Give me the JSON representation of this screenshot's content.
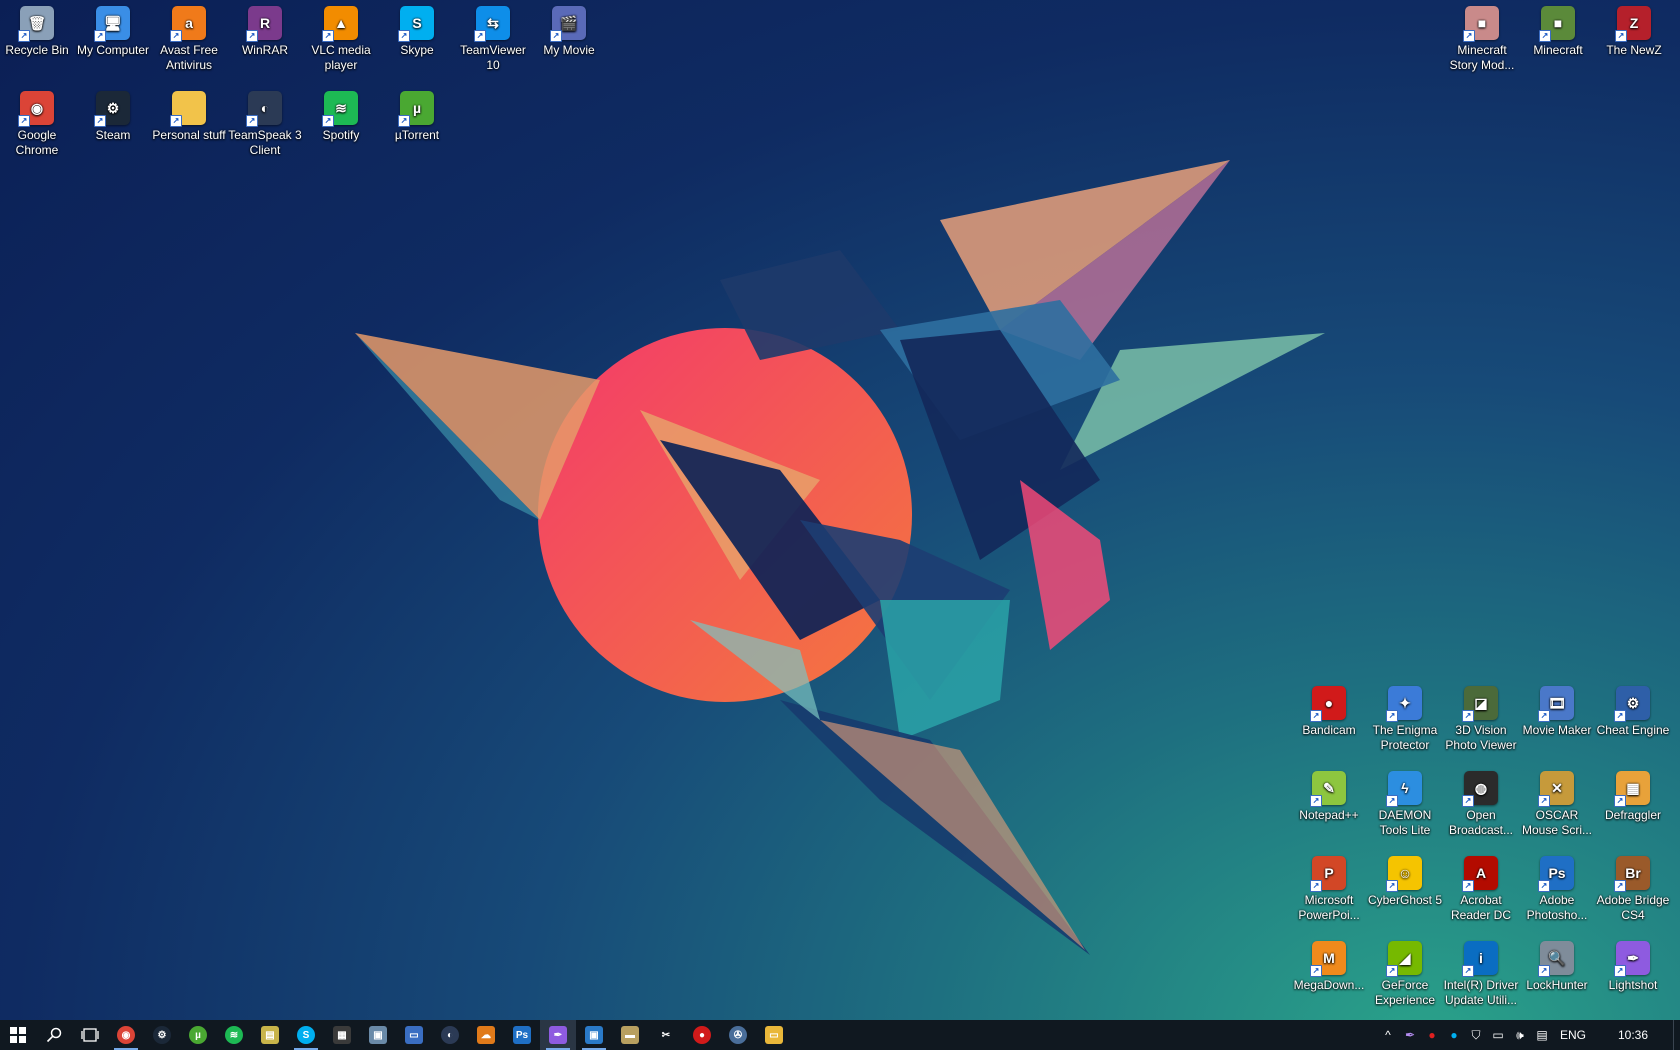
{
  "desktop": {
    "icons_left": [
      {
        "label": "Recycle Bin",
        "icon": "recycle-bin-icon",
        "glyph": "🗑",
        "color": "#8aa0b8"
      },
      {
        "label": "My Computer",
        "icon": "computer-icon",
        "glyph": "🖥",
        "color": "#3a8ee6"
      },
      {
        "label": "Avast Free Antivirus",
        "icon": "avast-icon",
        "glyph": "a",
        "color": "#f07a1a"
      },
      {
        "label": "WinRAR",
        "icon": "winrar-icon",
        "glyph": "R",
        "color": "#7b3a8c"
      },
      {
        "label": "VLC media player",
        "icon": "vlc-icon",
        "glyph": "▲",
        "color": "#f28c00"
      },
      {
        "label": "Skype",
        "icon": "skype-icon",
        "glyph": "S",
        "color": "#00aff0"
      },
      {
        "label": "TeamViewer 10",
        "icon": "teamviewer-icon",
        "glyph": "⇆",
        "color": "#0e8ee9"
      },
      {
        "label": "My Movie",
        "icon": "movie-icon",
        "glyph": "🎬",
        "color": "#5a6ab8"
      },
      {
        "label": "Google Chrome",
        "icon": "chrome-icon",
        "glyph": "◉",
        "color": "#db4437"
      },
      {
        "label": "Steam",
        "icon": "steam-icon",
        "glyph": "⚙",
        "color": "#1b2838"
      },
      {
        "label": "Personal stuff",
        "icon": "folder-icon",
        "glyph": "",
        "color": "#f2c34a"
      },
      {
        "label": "TeamSpeak 3 Client",
        "icon": "teamspeak-icon",
        "glyph": "◐",
        "color": "#2b3a55"
      },
      {
        "label": "Spotify",
        "icon": "spotify-icon",
        "glyph": "≋",
        "color": "#1db954"
      },
      {
        "label": "µTorrent",
        "icon": "utorrent-icon",
        "glyph": "µ",
        "color": "#4aa832"
      }
    ],
    "icons_top_right": [
      {
        "label": "Minecraft Story Mod...",
        "icon": "minecraft-story-icon",
        "glyph": "■",
        "color": "#c98a8a"
      },
      {
        "label": "Minecraft",
        "icon": "minecraft-icon",
        "glyph": "■",
        "color": "#5b8a3a"
      },
      {
        "label": "The NewZ",
        "icon": "thenewz-icon",
        "glyph": "Z",
        "color": "#b5202b"
      }
    ],
    "icons_bottom_right": [
      {
        "label": "Bandicam",
        "icon": "bandicam-icon",
        "glyph": "●",
        "color": "#d11a1a"
      },
      {
        "label": "The Enigma Protector",
        "icon": "enigma-icon",
        "glyph": "✦",
        "color": "#3b7bd8"
      },
      {
        "label": "3D Vision Photo Viewer",
        "icon": "3d-vision-icon",
        "glyph": "◪",
        "color": "#4b6a3a"
      },
      {
        "label": "Movie Maker",
        "icon": "movie-maker-icon",
        "glyph": "🎞",
        "color": "#4a78c9"
      },
      {
        "label": "Cheat Engine",
        "icon": "cheat-engine-icon",
        "glyph": "⚙",
        "color": "#2e5fa8"
      },
      {
        "label": "Notepad++",
        "icon": "notepadpp-icon",
        "glyph": "✎",
        "color": "#8dc63f"
      },
      {
        "label": "DAEMON Tools Lite",
        "icon": "daemon-tools-icon",
        "glyph": "ϟ",
        "color": "#2c8ee0"
      },
      {
        "label": "Open Broadcast...",
        "icon": "obs-icon",
        "glyph": "◍",
        "color": "#2b2b2b"
      },
      {
        "label": "OSCAR Mouse Scri...",
        "icon": "oscar-icon",
        "glyph": "✕",
        "color": "#c69a3b"
      },
      {
        "label": "Defraggler",
        "icon": "defraggler-icon",
        "glyph": "▦",
        "color": "#e8a23a"
      },
      {
        "label": "Microsoft PowerPoi...",
        "icon": "powerpoint-icon",
        "glyph": "P",
        "color": "#d24726"
      },
      {
        "label": "CyberGhost 5",
        "icon": "cyberghost-icon",
        "glyph": "☺",
        "color": "#f5c400"
      },
      {
        "label": "Acrobat Reader DC",
        "icon": "acrobat-icon",
        "glyph": "A",
        "color": "#b30b00"
      },
      {
        "label": "Adobe Photosho...",
        "icon": "photoshop-icon",
        "glyph": "Ps",
        "color": "#1f6fc5"
      },
      {
        "label": "Adobe Bridge CS4",
        "icon": "adobe-bridge-icon",
        "glyph": "Br",
        "color": "#9a5a2a"
      },
      {
        "label": "MegaDown...",
        "icon": "megadownloader-icon",
        "glyph": "M",
        "color": "#f08a1c"
      },
      {
        "label": "GeForce Experience",
        "icon": "geforce-icon",
        "glyph": "◢",
        "color": "#76b900"
      },
      {
        "label": "Intel(R) Driver Update Utili...",
        "icon": "intel-icon",
        "glyph": "i",
        "color": "#0a6dc2"
      },
      {
        "label": "LockHunter",
        "icon": "lockhunter-icon",
        "glyph": "🔍",
        "color": "#7f8c9a"
      },
      {
        "label": "Lightshot",
        "icon": "lightshot-icon",
        "glyph": "✒",
        "color": "#8e5be0"
      }
    ]
  },
  "taskbar": {
    "start": {
      "icon": "windows-start-icon"
    },
    "search": {
      "icon": "search-icon",
      "glyph": "⌕"
    },
    "task_view": {
      "icon": "task-view-icon",
      "glyph": "❐"
    },
    "apps": [
      {
        "name": "chrome",
        "icon": "chrome-icon",
        "glyph": "◉",
        "color": "#db4437",
        "round": true,
        "running": true
      },
      {
        "name": "steam",
        "icon": "steam-icon",
        "glyph": "⚙",
        "color": "#1b2838",
        "round": true,
        "running": false
      },
      {
        "name": "utorrent",
        "icon": "utorrent-icon",
        "glyph": "µ",
        "color": "#4aa832",
        "round": true,
        "running": false
      },
      {
        "name": "spotify",
        "icon": "spotify-icon",
        "glyph": "≋",
        "color": "#1db954",
        "round": true,
        "running": false
      },
      {
        "name": "folders",
        "icon": "folders-icon",
        "glyph": "▤",
        "color": "#c8b44a",
        "round": false,
        "running": false
      },
      {
        "name": "skype",
        "icon": "skype-icon",
        "glyph": "S",
        "color": "#00aff0",
        "round": true,
        "running": true
      },
      {
        "name": "calculator",
        "icon": "calculator-icon",
        "glyph": "▦",
        "color": "#3a3a3a",
        "round": false,
        "running": false
      },
      {
        "name": "photos",
        "icon": "photos-icon",
        "glyph": "▣",
        "color": "#6a8aa8",
        "round": false,
        "running": false
      },
      {
        "name": "app-blue",
        "icon": "app-icon",
        "glyph": "▭",
        "color": "#3a6ec2",
        "round": false,
        "running": false
      },
      {
        "name": "teamspeak",
        "icon": "teamspeak-icon",
        "glyph": "◐",
        "color": "#2b3a55",
        "round": true,
        "running": false
      },
      {
        "name": "cloud",
        "icon": "cloud-icon",
        "glyph": "☁",
        "color": "#e07a1a",
        "round": false,
        "running": false
      },
      {
        "name": "photoshop",
        "icon": "photoshop-icon",
        "glyph": "Ps",
        "color": "#1f6fc5",
        "round": false,
        "running": false
      },
      {
        "name": "lightshot",
        "icon": "lightshot-icon",
        "glyph": "✒",
        "color": "#8e5be0",
        "round": false,
        "running": true,
        "active": true
      },
      {
        "name": "remote",
        "icon": "monitor-icon",
        "glyph": "▣",
        "color": "#2a7ac8",
        "round": false,
        "running": true
      },
      {
        "name": "app-misc",
        "icon": "app-icon",
        "glyph": "▬",
        "color": "#b8a060",
        "round": false,
        "running": false
      },
      {
        "name": "snipping",
        "icon": "scissors-icon",
        "glyph": "✂",
        "color": "#101820",
        "round": false,
        "running": false
      },
      {
        "name": "bandicam",
        "icon": "bandicam-icon",
        "glyph": "●",
        "color": "#d11a1a",
        "round": true,
        "running": false
      },
      {
        "name": "game",
        "icon": "gamepad-icon",
        "glyph": "✇",
        "color": "#4a6e9a",
        "round": true,
        "running": false
      },
      {
        "name": "explorer",
        "icon": "file-explorer-icon",
        "glyph": "▭",
        "color": "#e9b73a",
        "round": false,
        "running": false
      }
    ],
    "tray": {
      "chevron": "^",
      "lang": "ENG",
      "time": "10:36"
    }
  }
}
